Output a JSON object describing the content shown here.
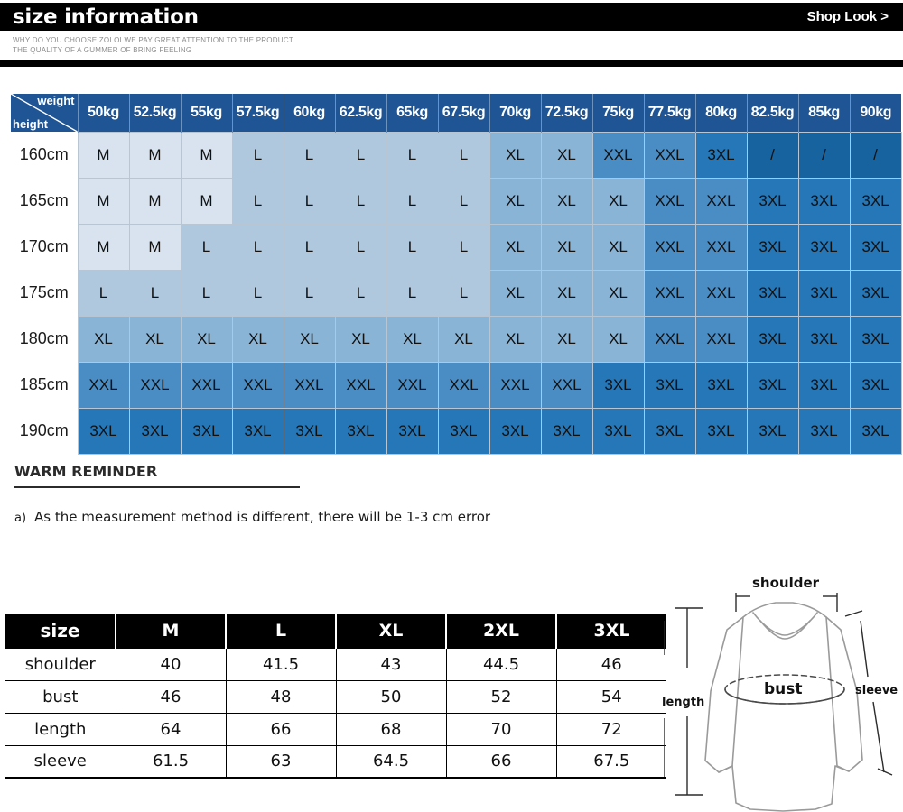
{
  "header": {
    "title": "size information",
    "shop_link": "Shop Look >",
    "subtitle_line1": "WHY DO YOU CHOOSE ZOLOI WE PAY GREAT ATTENTION TO THE PRODUCT",
    "subtitle_line2": "THE QUALITY OF A GUMMER OF BRING FEELING"
  },
  "size_grid": {
    "axis_weight_label": "weight",
    "axis_height_label": "height",
    "weights": [
      "50kg",
      "52.5kg",
      "55kg",
      "57.5kg",
      "60kg",
      "62.5kg",
      "65kg",
      "67.5kg",
      "70kg",
      "72.5kg",
      "75kg",
      "77.5kg",
      "80kg",
      "82.5kg",
      "85kg",
      "90kg"
    ],
    "heights": [
      "160cm",
      "165cm",
      "170cm",
      "175cm",
      "180cm",
      "185cm",
      "190cm"
    ],
    "rows": [
      [
        "M",
        "M",
        "M",
        "L",
        "L",
        "L",
        "L",
        "L",
        "XL",
        "XL",
        "XXL",
        "XXL",
        "3XL",
        "/",
        "/",
        "/"
      ],
      [
        "M",
        "M",
        "M",
        "L",
        "L",
        "L",
        "L",
        "L",
        "XL",
        "XL",
        "XL",
        "XXL",
        "XXL",
        "3XL",
        "3XL",
        "3XL"
      ],
      [
        "M",
        "M",
        "L",
        "L",
        "L",
        "L",
        "L",
        "L",
        "XL",
        "XL",
        "XL",
        "XXL",
        "XXL",
        "3XL",
        "3XL",
        "3XL"
      ],
      [
        "L",
        "L",
        "L",
        "L",
        "L",
        "L",
        "L",
        "L",
        "XL",
        "XL",
        "XL",
        "XXL",
        "XXL",
        "3XL",
        "3XL",
        "3XL"
      ],
      [
        "XL",
        "XL",
        "XL",
        "XL",
        "XL",
        "XL",
        "XL",
        "XL",
        "XL",
        "XL",
        "XL",
        "XXL",
        "XXL",
        "3XL",
        "3XL",
        "3XL"
      ],
      [
        "XXL",
        "XXL",
        "XXL",
        "XXL",
        "XXL",
        "XXL",
        "XXL",
        "XXL",
        "XXL",
        "XXL",
        "3XL",
        "3XL",
        "3XL",
        "3XL",
        "3XL",
        "3XL"
      ],
      [
        "3XL",
        "3XL",
        "3XL",
        "3XL",
        "3XL",
        "3XL",
        "3XL",
        "3XL",
        "3XL",
        "3XL",
        "3XL",
        "3XL",
        "3XL",
        "3XL",
        "3XL",
        "3XL"
      ]
    ],
    "colors": {
      "header_blue": "#1f5594",
      "M": "#d8e3ef",
      "L": "#afc8de",
      "XL": "#8ab4d6",
      "XXL": "#4a8cc4",
      "3XL": "#2677b8",
      "NA": "#17639f"
    }
  },
  "warm_reminder": {
    "title": "WARM REMINDER",
    "marker": "a)",
    "note": "As the measurement method is different, there will be 1-3 cm error"
  },
  "measurements": {
    "corner_label": "size",
    "columns": [
      "M",
      "L",
      "XL",
      "2XL",
      "3XL"
    ],
    "rows": [
      {
        "label": "shoulder",
        "values": [
          "40",
          "41.5",
          "43",
          "44.5",
          "46"
        ]
      },
      {
        "label": "bust",
        "values": [
          "46",
          "48",
          "50",
          "52",
          "54"
        ]
      },
      {
        "label": "length",
        "values": [
          "64",
          "66",
          "68",
          "70",
          "72"
        ]
      },
      {
        "label": "sleeve",
        "values": [
          "61.5",
          "63",
          "64.5",
          "66",
          "67.5"
        ]
      }
    ]
  },
  "garment_diagram": {
    "shoulder_label": "shoulder",
    "bust_label": "bust",
    "length_label": "length",
    "sleeve_label": "sleeve"
  }
}
